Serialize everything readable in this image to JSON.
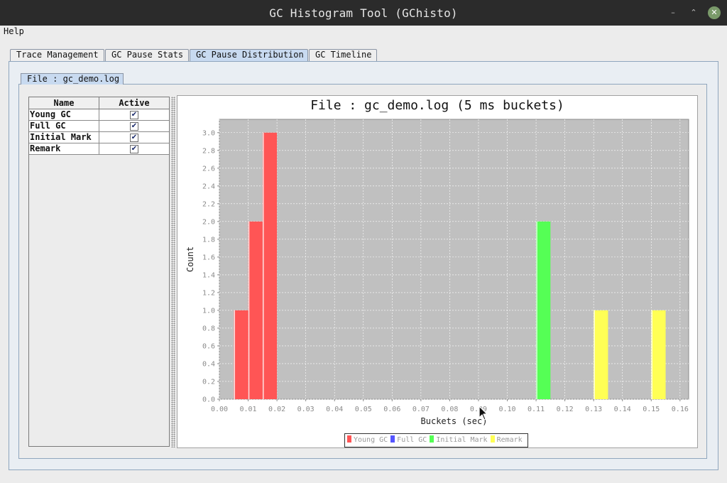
{
  "window": {
    "title": "GC Histogram Tool (GChisto)",
    "minimize_glyph": "–",
    "maximize_glyph": "⌃",
    "close_glyph": "✕"
  },
  "menu": {
    "help": "Help"
  },
  "tabs": [
    {
      "label": "Trace Management",
      "selected": false
    },
    {
      "label": "GC Pause Stats",
      "selected": false
    },
    {
      "label": "GC Pause Distribution",
      "selected": true
    },
    {
      "label": "GC Timeline",
      "selected": false
    }
  ],
  "file_tab": {
    "label": "File : gc_demo.log"
  },
  "table": {
    "headers": {
      "name": "Name",
      "active": "Active"
    },
    "rows": [
      {
        "name": "Young GC",
        "active": true,
        "check": "✔"
      },
      {
        "name": "Full GC",
        "active": true,
        "check": "✔"
      },
      {
        "name": "Initial Mark",
        "active": true,
        "check": "✔"
      },
      {
        "name": "Remark",
        "active": true,
        "check": "✔"
      }
    ]
  },
  "colors": {
    "young_gc": "#ff5555",
    "full_gc": "#5555ff",
    "initial_mark": "#55ff55",
    "remark": "#ffff55",
    "plot_background": "#c0c0c0"
  },
  "chart_data": {
    "type": "bar",
    "title": "File : gc_demo.log (5 ms buckets)",
    "xlabel": "Buckets (sec)",
    "ylabel": "Count",
    "xlim": [
      0.0,
      0.163
    ],
    "ylim": [
      0.0,
      3.15
    ],
    "x_ticks": [
      "0.00",
      "0.01",
      "0.02",
      "0.03",
      "0.04",
      "0.05",
      "0.06",
      "0.07",
      "0.08",
      "0.09",
      "0.10",
      "0.11",
      "0.12",
      "0.13",
      "0.14",
      "0.15",
      "0.16"
    ],
    "y_ticks": [
      "0.0",
      "0.2",
      "0.4",
      "0.6",
      "0.8",
      "1.0",
      "1.2",
      "1.4",
      "1.6",
      "1.8",
      "2.0",
      "2.2",
      "2.4",
      "2.6",
      "2.8",
      "3.0"
    ],
    "bucket_width": 0.005,
    "grid": true,
    "legend_position": "bottom",
    "series": [
      {
        "name": "Young GC",
        "color": "#ff5555",
        "points": [
          {
            "x": 0.005,
            "y": 1
          },
          {
            "x": 0.01,
            "y": 2
          },
          {
            "x": 0.015,
            "y": 3
          }
        ]
      },
      {
        "name": "Full GC",
        "color": "#5555ff",
        "points": []
      },
      {
        "name": "Initial Mark",
        "color": "#55ff55",
        "points": [
          {
            "x": 0.11,
            "y": 2
          }
        ]
      },
      {
        "name": "Remark",
        "color": "#ffff55",
        "points": [
          {
            "x": 0.13,
            "y": 1
          },
          {
            "x": 0.15,
            "y": 1
          }
        ]
      }
    ]
  }
}
